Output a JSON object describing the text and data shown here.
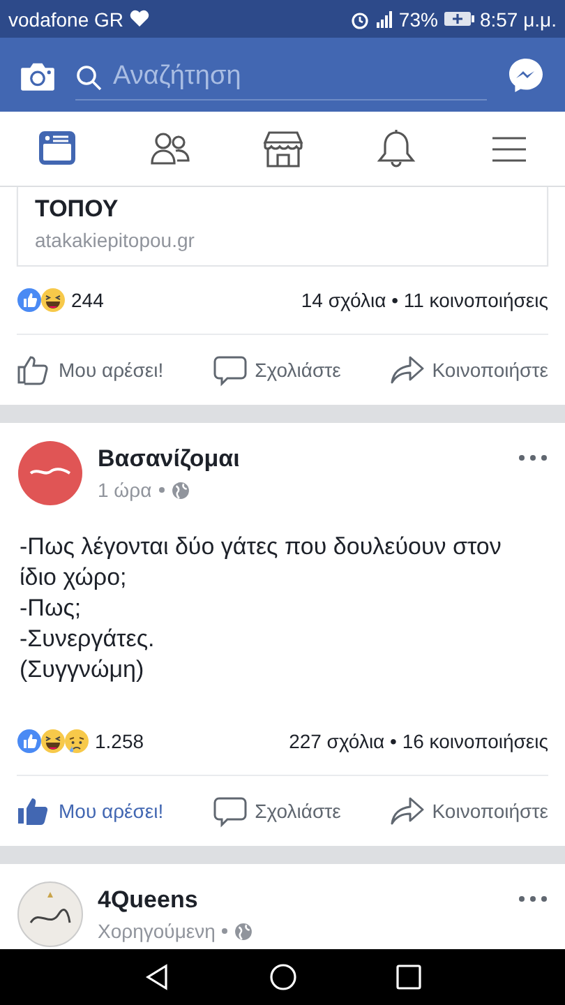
{
  "status_bar": {
    "carrier": "vodafone GR",
    "battery": "73%",
    "time": "8:57 μ.μ."
  },
  "search": {
    "placeholder": "Αναζήτηση"
  },
  "tabs": [
    {
      "kind": "news",
      "selected": true
    },
    {
      "kind": "friends",
      "selected": false
    },
    {
      "kind": "market",
      "selected": false
    },
    {
      "kind": "bell",
      "selected": false
    },
    {
      "kind": "menu",
      "selected": false
    }
  ],
  "posts": [
    {
      "link": {
        "title": "ΤΟΠΟΥ",
        "domain": "atakakiepitopou.gr"
      },
      "reactions": [
        {
          "kind": "like"
        },
        {
          "kind": "haha"
        }
      ],
      "reaction_count": "244",
      "stats": "14 σχόλια • 11 κοινοποιήσεις",
      "actions": [
        {
          "kind": "like",
          "label": "Μου αρέσει!",
          "active": false
        },
        {
          "kind": "comment",
          "label": "Σχολιάστε",
          "active": false
        },
        {
          "kind": "share",
          "label": "Κοινοποιήστε",
          "active": false
        }
      ]
    },
    {
      "author": "Βασανίζομαι",
      "avatar": {
        "kind": "picture"
      },
      "meta": "1 ώρα",
      "text_lines": [
        "-Πως λέγονται δύο γάτες που δουλεύουν στον ίδιο χώρο;",
        "-Πως;",
        "-Συνεργάτες.",
        "(Συγγνώμη)"
      ],
      "reactions": [
        {
          "kind": "like"
        },
        {
          "kind": "haha"
        },
        {
          "kind": "sad"
        }
      ],
      "reaction_count": "1.258",
      "stats": "227 σχόλια • 16 κοινοποιήσεις",
      "actions": [
        {
          "kind": "like",
          "label": "Μου αρέσει!",
          "active": true
        },
        {
          "kind": "comment",
          "label": "Σχολιάστε",
          "active": false
        },
        {
          "kind": "share",
          "label": "Κοινοποιήστε",
          "active": false
        }
      ]
    },
    {
      "author": "4Queens",
      "avatar": {
        "kind": "picture"
      },
      "meta": "Χορηγούμενη"
    }
  ]
}
